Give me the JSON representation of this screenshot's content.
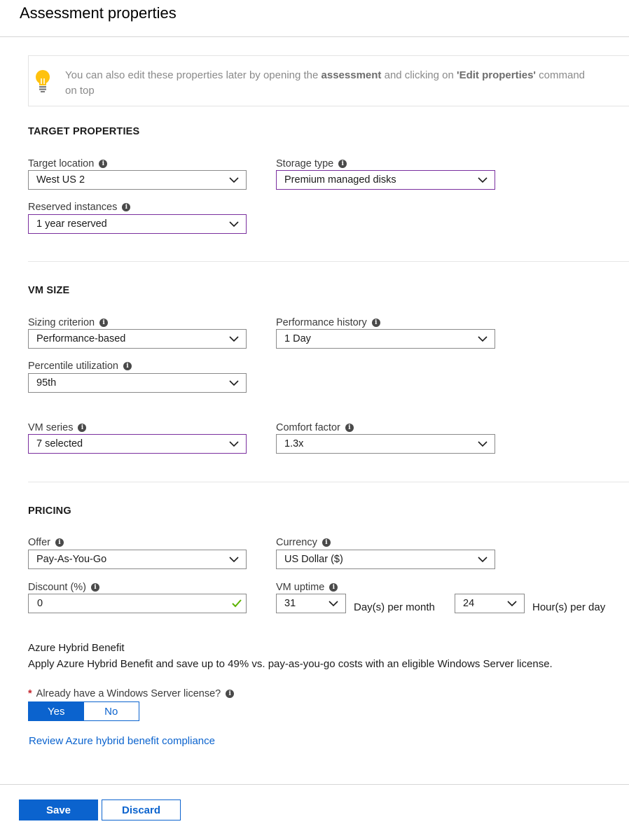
{
  "page": {
    "title": "Assessment properties"
  },
  "banner": {
    "text_1": "You can also edit these properties later by opening the ",
    "bold_1": "assessment",
    "text_2": " and clicking on ",
    "bold_2": "'Edit properties'",
    "text_3": " command on top",
    "icon": "lightbulb-icon"
  },
  "target_properties": {
    "heading": "TARGET PROPERTIES",
    "target_location": {
      "label": "Target location",
      "value": "West US 2"
    },
    "storage_type": {
      "label": "Storage type",
      "value": "Premium managed disks"
    },
    "reserved_instances": {
      "label": "Reserved instances",
      "value": "1 year reserved"
    }
  },
  "vm_size": {
    "heading": "VM SIZE",
    "sizing_criterion": {
      "label": "Sizing criterion",
      "value": "Performance-based"
    },
    "performance_history": {
      "label": "Performance history",
      "value": "1 Day"
    },
    "percentile_utilization": {
      "label": "Percentile utilization",
      "value": "95th"
    },
    "vm_series": {
      "label": "VM series",
      "value": "7 selected"
    },
    "comfort_factor": {
      "label": "Comfort factor",
      "value": "1.3x"
    }
  },
  "pricing": {
    "heading": "PRICING",
    "offer": {
      "label": "Offer",
      "value": "Pay-As-You-Go"
    },
    "currency": {
      "label": "Currency",
      "value": "US Dollar ($)"
    },
    "discount": {
      "label": "Discount (%)",
      "value": "0"
    },
    "vm_uptime": {
      "label": "VM uptime",
      "days_value": "31",
      "days_unit": "Day(s) per month",
      "hours_value": "24",
      "hours_unit": "Hour(s) per day"
    }
  },
  "hybrid_benefit": {
    "title": "Azure Hybrid Benefit",
    "description": "Apply Azure Hybrid Benefit and save up to 49% vs. pay-as-you-go costs with an eligible Windows Server license.",
    "question": "Already have a Windows Server license?",
    "required_mark": "*",
    "yes_label": "Yes",
    "no_label": "No",
    "selected": "Yes",
    "compliance_link": "Review Azure hybrid benefit compliance"
  },
  "footer": {
    "save_label": "Save",
    "discard_label": "Discard"
  },
  "colors": {
    "accent": "#0b63ce",
    "active_border": "#7a2f9e",
    "valid_check": "#5cb300",
    "required": "#c4262e"
  }
}
